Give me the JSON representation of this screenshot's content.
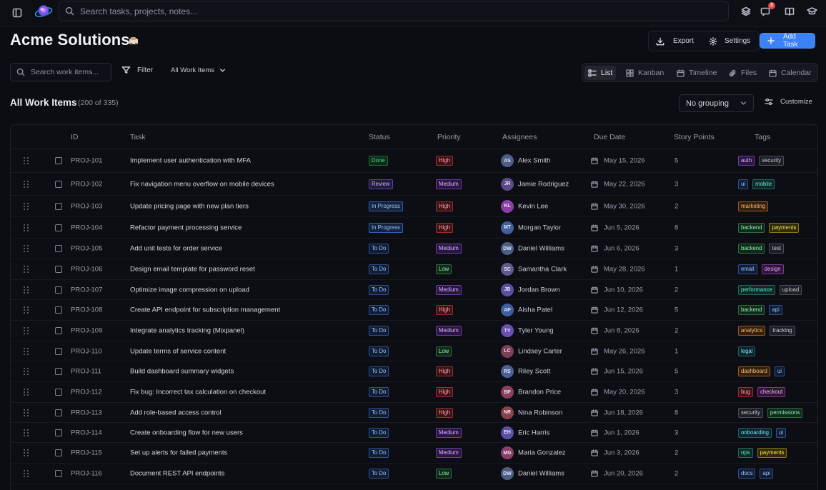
{
  "topbar": {
    "search_placeholder": "Search tasks, projects, notes...",
    "notification_count": "3"
  },
  "header": {
    "title": "Acme Solutions",
    "export_label": "Export",
    "settings_label": "Settings",
    "add_task_label": "Add Task"
  },
  "toolbar": {
    "search_placeholder": "Search work items...",
    "filter_label": "Filter",
    "scope_label": "All Work Items"
  },
  "views": [
    {
      "label": "List",
      "icon": "list-icon",
      "active": true
    },
    {
      "label": "Kanban",
      "icon": "kanban-icon",
      "active": false
    },
    {
      "label": "Timeline",
      "icon": "timeline-icon",
      "active": false
    },
    {
      "label": "Files",
      "icon": "paperclip-icon",
      "active": false
    },
    {
      "label": "Calendar",
      "icon": "calendar-icon",
      "active": false
    }
  ],
  "list": {
    "heading": "All Work Items",
    "count": "(200 of 335)",
    "grouping": "No grouping",
    "customize_label": "Customize"
  },
  "columns": {
    "id": "ID",
    "task": "Task",
    "status": "Status",
    "priority": "Priority",
    "assignees": "Assignees",
    "due_date": "Due Date",
    "story_points": "Story Points",
    "tags": "Tags"
  },
  "colors": {
    "accent": "#3b82f6",
    "background": "#0c0d13"
  },
  "rows": [
    {
      "id": "PROJ-101",
      "task": "Implement user authentication with MFA",
      "status": "Done",
      "priority": "High",
      "initials": "AS",
      "assignee": "Alex Smith",
      "due": "May 15, 2026",
      "points": "5",
      "tags": [
        "auth",
        "security"
      ]
    },
    {
      "id": "PROJ-102",
      "task": "Fix navigation menu overflow on mobile devices",
      "status": "Review",
      "priority": "Medium",
      "initials": "JR",
      "assignee": "Jamie Rodriguez",
      "due": "May 22, 2026",
      "points": "3",
      "tags": [
        "ui",
        "mobile"
      ]
    },
    {
      "id": "PROJ-103",
      "task": "Update pricing page with new plan tiers",
      "status": "In Progress",
      "priority": "High",
      "initials": "KL",
      "assignee": "Kevin Lee",
      "due": "May 30, 2026",
      "points": "2",
      "tags": [
        "marketing"
      ]
    },
    {
      "id": "PROJ-104",
      "task": "Refactor payment processing service",
      "status": "In Progress",
      "priority": "High",
      "initials": "MT",
      "assignee": "Morgan Taylor",
      "due": "Jun 5, 2026",
      "points": "8",
      "tags": [
        "backend",
        "payments"
      ]
    },
    {
      "id": "PROJ-105",
      "task": "Add unit tests for order service",
      "status": "To Do",
      "priority": "Medium",
      "initials": "DW",
      "assignee": "Daniel Williams",
      "due": "Jun 6, 2026",
      "points": "3",
      "tags": [
        "backend",
        "test"
      ]
    },
    {
      "id": "PROJ-106",
      "task": "Design email template for password reset",
      "status": "To Do",
      "priority": "Low",
      "initials": "SC",
      "assignee": "Samantha Clark",
      "due": "May 28, 2026",
      "points": "1",
      "tags": [
        "email",
        "design"
      ]
    },
    {
      "id": "PROJ-107",
      "task": "Optimize image compression on upload",
      "status": "To Do",
      "priority": "Medium",
      "initials": "JB",
      "assignee": "Jordan Brown",
      "due": "Jun 10, 2026",
      "points": "2",
      "tags": [
        "performance",
        "upload"
      ]
    },
    {
      "id": "PROJ-108",
      "task": "Create API endpoint for subscription management",
      "status": "To Do",
      "priority": "High",
      "initials": "AP",
      "assignee": "Aisha Patel",
      "due": "Jun 12, 2026",
      "points": "5",
      "tags": [
        "backend",
        "api"
      ]
    },
    {
      "id": "PROJ-109",
      "task": "Integrate analytics tracking (Mixpanel)",
      "status": "To Do",
      "priority": "Medium",
      "initials": "TY",
      "assignee": "Tyler Young",
      "due": "Jun 8, 2026",
      "points": "2",
      "tags": [
        "analytics",
        "tracking"
      ]
    },
    {
      "id": "PROJ-110",
      "task": "Update terms of service content",
      "status": "To Do",
      "priority": "Low",
      "initials": "LC",
      "assignee": "Lindsey Carter",
      "due": "May 26, 2026",
      "points": "1",
      "tags": [
        "legal"
      ]
    },
    {
      "id": "PROJ-111",
      "task": "Build dashboard summary widgets",
      "status": "To Do",
      "priority": "High",
      "initials": "RS",
      "assignee": "Riley Scott",
      "due": "Jun 15, 2026",
      "points": "5",
      "tags": [
        "dashboard",
        "ui"
      ]
    },
    {
      "id": "PROJ-112",
      "task": "Fix bug: Incorrect tax calculation on checkout",
      "status": "To Do",
      "priority": "High",
      "initials": "BP",
      "assignee": "Brandon Price",
      "due": "May 20, 2026",
      "points": "3",
      "tags": [
        "bug",
        "checkout"
      ]
    },
    {
      "id": "PROJ-113",
      "task": "Add role-based access control",
      "status": "To Do",
      "priority": "High",
      "initials": "NR",
      "assignee": "Nina Robinson",
      "due": "Jun 18, 2026",
      "points": "8",
      "tags": [
        "security",
        "permissions"
      ]
    },
    {
      "id": "PROJ-114",
      "task": "Create onboarding flow for new users",
      "status": "To Do",
      "priority": "Medium",
      "initials": "EH",
      "assignee": "Eric Harris",
      "due": "Jun 1, 2026",
      "points": "3",
      "tags": [
        "onboarding",
        "ui"
      ]
    },
    {
      "id": "PROJ-115",
      "task": "Set up alerts for failed payments",
      "status": "To Do",
      "priority": "Medium",
      "initials": "MG",
      "assignee": "Maria Gonzalez",
      "due": "Jun 3, 2026",
      "points": "2",
      "tags": [
        "ops",
        "payments"
      ]
    },
    {
      "id": "PROJ-116",
      "task": "Document REST API endpoints",
      "status": "To Do",
      "priority": "Low",
      "initials": "DW",
      "assignee": "Daniel Williams",
      "due": "Jun 20, 2026",
      "points": "2",
      "tags": [
        "docs",
        "api"
      ]
    }
  ]
}
